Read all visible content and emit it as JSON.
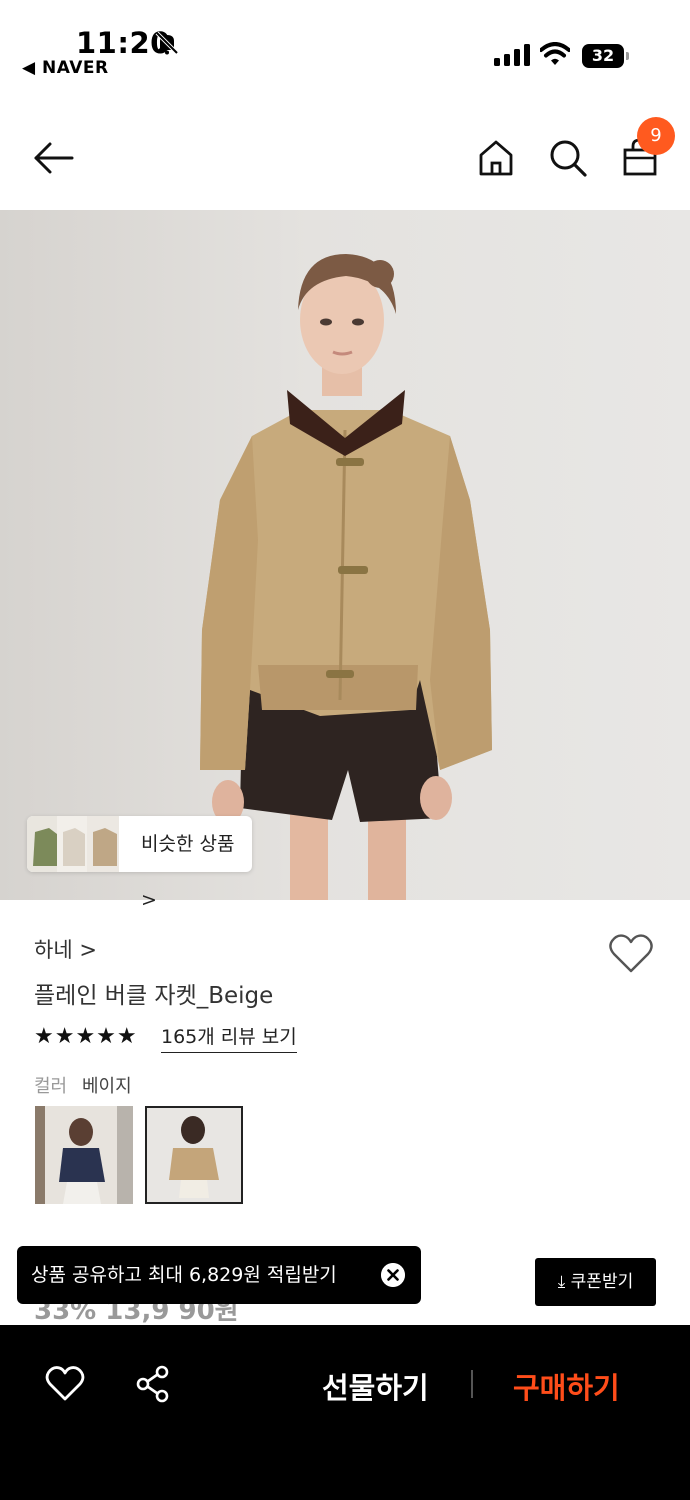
{
  "status_bar": {
    "time": "11:20",
    "back_app": "◀ NAVER",
    "battery": "32"
  },
  "header": {
    "cart_count": "9"
  },
  "hero": {
    "similar_label": "비슷한 상품 >"
  },
  "product": {
    "brand": "하네 >",
    "title": "플레인 버클 자켓_Beige",
    "stars": "★★★★★",
    "review_link": "165개 리뷰 보기",
    "option_label": "컬러",
    "option_value": "베이지",
    "price_peek": "33% 13,9 90원"
  },
  "toast": {
    "text": "상품 공유하고 최대 6,829원 적립받기"
  },
  "coupon": {
    "label": "⤓ 쿠폰받기"
  },
  "bottom_bar": {
    "gift_label": "선물하기",
    "buy_label": "구매하기"
  },
  "colors": {
    "accent": "#ff4d1a",
    "badge": "#ff5a1f",
    "bar": "#000000"
  }
}
